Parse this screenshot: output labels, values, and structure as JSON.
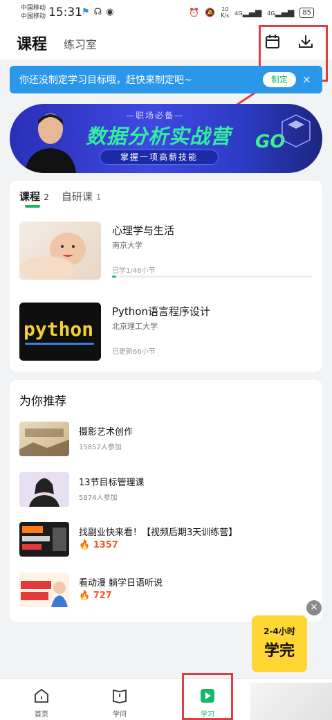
{
  "status_bar": {
    "carrier1": "中国移动",
    "carrier2": "中国移动",
    "time": "15:31",
    "net_speed_value": "10",
    "net_speed_unit": "K/s",
    "signal1": "4G",
    "signal2": "4G",
    "battery": "85"
  },
  "header": {
    "title": "课程",
    "tab_practice": "练习室",
    "calendar_icon": "calendar-icon",
    "download_icon": "download-icon"
  },
  "goal_banner": {
    "text": "你还没制定学习目标哦，赶快来制定吧~",
    "button": "制定",
    "close": "×"
  },
  "ad_banner": {
    "subtitle": "—职场必备—",
    "headline": "数据分析实战营",
    "pill": "掌握一项高薪技能",
    "go": "GO"
  },
  "courses": {
    "tabs": [
      {
        "label": "课程",
        "count": "2"
      },
      {
        "label": "自研课",
        "count": "1"
      }
    ],
    "items": [
      {
        "name": "心理学与生活",
        "school": "南京大学",
        "progress_text": "已学1/46小节",
        "progress": 0.022
      },
      {
        "name": "Python语言程序设计",
        "school": "北京理工大学",
        "progress_text": "已更新66小节",
        "thumb_text": "python"
      }
    ]
  },
  "recommend": {
    "title": "为你推荐",
    "items": [
      {
        "name": "摄影艺术创作",
        "meta": "15857人参加"
      },
      {
        "name": "13节目标管理课",
        "meta": "5874人参加"
      },
      {
        "name": "找副业快来看！【视频后期3天训练营】",
        "hot": "1357"
      },
      {
        "name": "看动漫 躺学日语听说",
        "hot": "727"
      }
    ]
  },
  "promo": {
    "top": "2-4小时",
    "main": "学完",
    "close": "×"
  },
  "bottom_nav": {
    "items": [
      {
        "label": "首页"
      },
      {
        "label": "学问"
      },
      {
        "label": "学习"
      }
    ]
  },
  "colors": {
    "accent": "#18b86b",
    "highlight": "#e43b43",
    "goal_bg": "#2b97e8",
    "hot": "#f0592a"
  }
}
